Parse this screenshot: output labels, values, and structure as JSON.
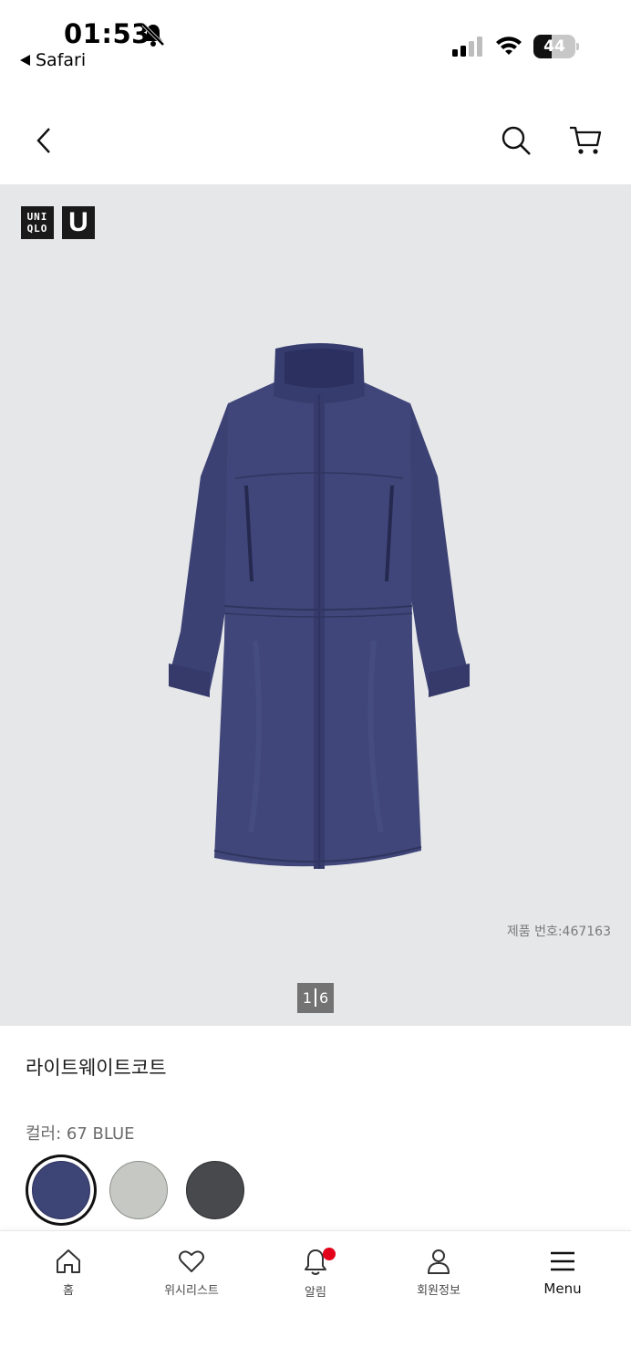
{
  "status_bar": {
    "time": "01:53",
    "back_app": "Safari",
    "battery_level": "44",
    "battery_fraction": 0.44
  },
  "header": {
    "icons": [
      "back-icon",
      "search-icon",
      "cart-icon"
    ]
  },
  "gallery": {
    "brand_logo_text": "UNI QLO",
    "brand_u_text": "U",
    "product_number": "제품 번호:467163",
    "pager_current": "1",
    "pager_total": "6",
    "background": "#e6e7e9",
    "coat_color": "#3f4478"
  },
  "product": {
    "title": "라이트웨이트코트",
    "color_label": "컬러: 67 BLUE",
    "swatches": [
      {
        "name": "BLUE",
        "color": "#3d4476",
        "selected": true
      },
      {
        "name": "GRAY",
        "color": "#c5c8c3",
        "selected": false
      },
      {
        "name": "DARK GRAY",
        "color": "#48494d",
        "selected": false
      }
    ]
  },
  "bottom_nav": {
    "items": [
      {
        "label": "홈",
        "icon": "home-icon"
      },
      {
        "label": "위시리스트",
        "icon": "heart-icon"
      },
      {
        "label": "알림",
        "icon": "bell-icon",
        "badge": true
      },
      {
        "label": "회원정보",
        "icon": "user-icon"
      },
      {
        "label": "Menu",
        "icon": "menu-icon"
      }
    ],
    "badge_color": "#e3001b"
  }
}
